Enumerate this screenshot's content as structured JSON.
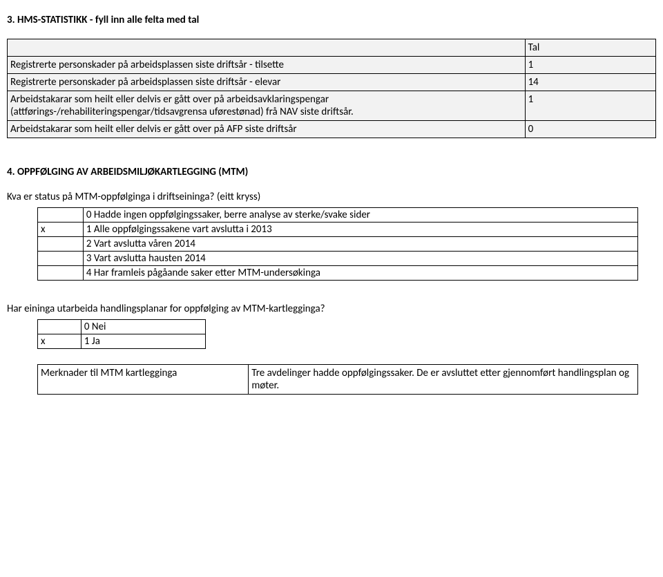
{
  "section3": {
    "heading": "3. HMS-STATISTIKK - fyll inn alle felta med tal",
    "col_header": "Tal",
    "rows": [
      {
        "label": "Registrerte personskader på arbeidsplassen siste driftsår - tilsette",
        "value": "1"
      },
      {
        "label": "Registrerte personskader på arbeidsplassen siste driftsår - elevar",
        "value": "14"
      },
      {
        "label": "Arbeidstakarar som heilt eller delvis er gått over på arbeidsavklaringspengar (attførings-/rehabiliteringspengar/tidsavgrensa uførestønad) frå NAV siste driftsår.",
        "value": "1"
      },
      {
        "label": "Arbeidstakarar som heilt eller delvis er gått over på AFP siste driftsår",
        "value": "0"
      }
    ]
  },
  "section4": {
    "heading": "4. OPPFØLGING AV ARBEIDSMILJØKARTLEGGING (MTM)",
    "question1": "Kva er status på MTM-oppfølginga i driftseininga? (eitt kryss)",
    "options": [
      {
        "mark": "",
        "text": "0 Hadde ingen oppfølgingssaker, berre analyse av sterke/svake sider"
      },
      {
        "mark": "x",
        "text": "1 Alle oppfølgingssakene vart avslutta i 2013"
      },
      {
        "mark": "",
        "text": "2 Vart avslutta våren 2014"
      },
      {
        "mark": "",
        "text": "3 Vart avslutta hausten 2014"
      },
      {
        "mark": "",
        "text": "4 Har framleis pågåande saker etter MTM-undersøkinga"
      }
    ],
    "question2": "Har eininga utarbeida handlingsplanar for oppfølging av MTM-kartlegginga?",
    "yesno": [
      {
        "mark": "",
        "text": "0 Nei"
      },
      {
        "mark": "x",
        "text": "1 Ja"
      }
    ],
    "remarks_label": "Merknader til MTM kartlegginga",
    "remarks_text": "Tre avdelinger hadde oppfølgingssaker. De er avsluttet etter gjennomført handlingsplan og møter."
  }
}
